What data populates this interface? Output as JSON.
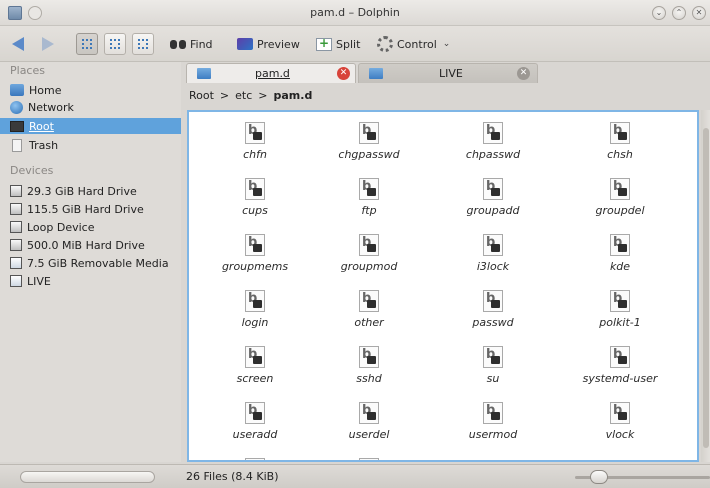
{
  "window": {
    "title": "pam.d – Dolphin"
  },
  "toolbar": {
    "find_label": "Find",
    "preview_label": "Preview",
    "split_label": "Split",
    "control_label": "Control"
  },
  "sidebar": {
    "places_heading": "Places",
    "places": [
      {
        "label": "Home",
        "icon": "home-folder-icon"
      },
      {
        "label": "Network",
        "icon": "network-icon"
      },
      {
        "label": "Root",
        "icon": "root-icon",
        "selected": true
      },
      {
        "label": "Trash",
        "icon": "trash-icon"
      }
    ],
    "devices_heading": "Devices",
    "devices": [
      {
        "label": "29.3 GiB Hard Drive",
        "icon": "hard-drive-icon"
      },
      {
        "label": "115.5 GiB Hard Drive",
        "icon": "hard-drive-icon"
      },
      {
        "label": "Loop Device",
        "icon": "hard-drive-icon"
      },
      {
        "label": "500.0 MiB Hard Drive",
        "icon": "hard-drive-icon"
      },
      {
        "label": "7.5 GiB Removable Media",
        "icon": "usb-drive-icon"
      },
      {
        "label": "LIVE",
        "icon": "usb-drive-icon"
      }
    ]
  },
  "tabs": [
    {
      "label": "pam.d",
      "active": true
    },
    {
      "label": "LIVE",
      "active": false
    }
  ],
  "breadcrumb": {
    "root": "Root",
    "sep1": ">",
    "dir": "etc",
    "sep2": ">",
    "current": "pam.d"
  },
  "files": [
    "chfn",
    "chgpasswd",
    "chpasswd",
    "chsh",
    "cups",
    "ftp",
    "groupadd",
    "groupdel",
    "groupmems",
    "groupmod",
    "i3lock",
    "kde",
    "login",
    "other",
    "passwd",
    "polkit-1",
    "screen",
    "sshd",
    "su",
    "systemd-user",
    "useradd",
    "userdel",
    "usermod",
    "vlock"
  ],
  "status": {
    "text": "26 Files (8.4 KiB)"
  },
  "colors": {
    "selection": "#5fa2dc",
    "view_border": "#7fb6e6",
    "close_red": "#d8433a"
  }
}
